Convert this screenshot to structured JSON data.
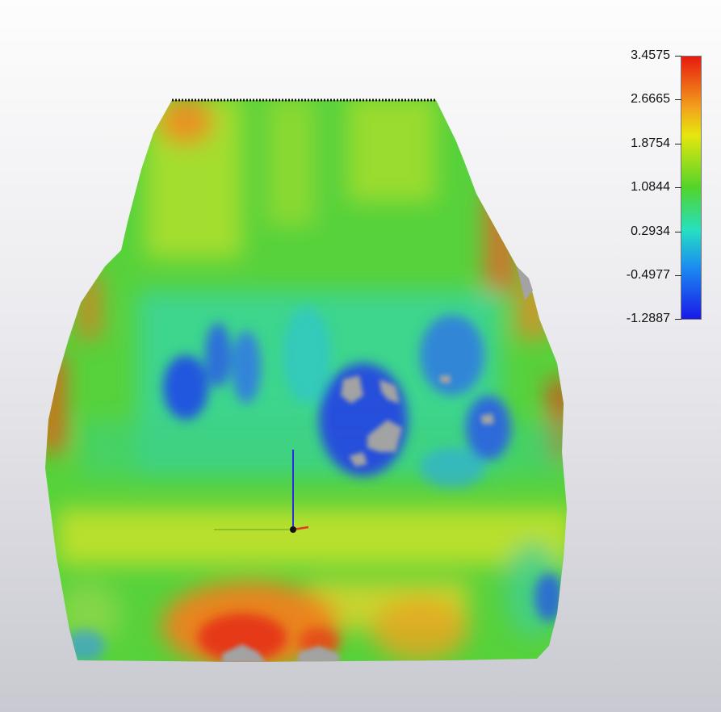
{
  "colorbar": {
    "labels": [
      "3.4575",
      "2.6665",
      "1.8754",
      "1.0844",
      "0.2934",
      "-0.4977",
      "-1.2887"
    ],
    "colors": [
      "#e81a10",
      "#f2a51c",
      "#e6e60e",
      "#52d42a",
      "#27e0c0",
      "#1b8ef0",
      "#1919e8"
    ],
    "max": 3.4575,
    "min": -1.2887
  },
  "surface": {
    "no_data_color": "#a3a3a3"
  },
  "axes_gizmo": {
    "z_color": "#2d2de6",
    "x_color": "#e03a2a",
    "y_color": "#8cbf2a"
  }
}
